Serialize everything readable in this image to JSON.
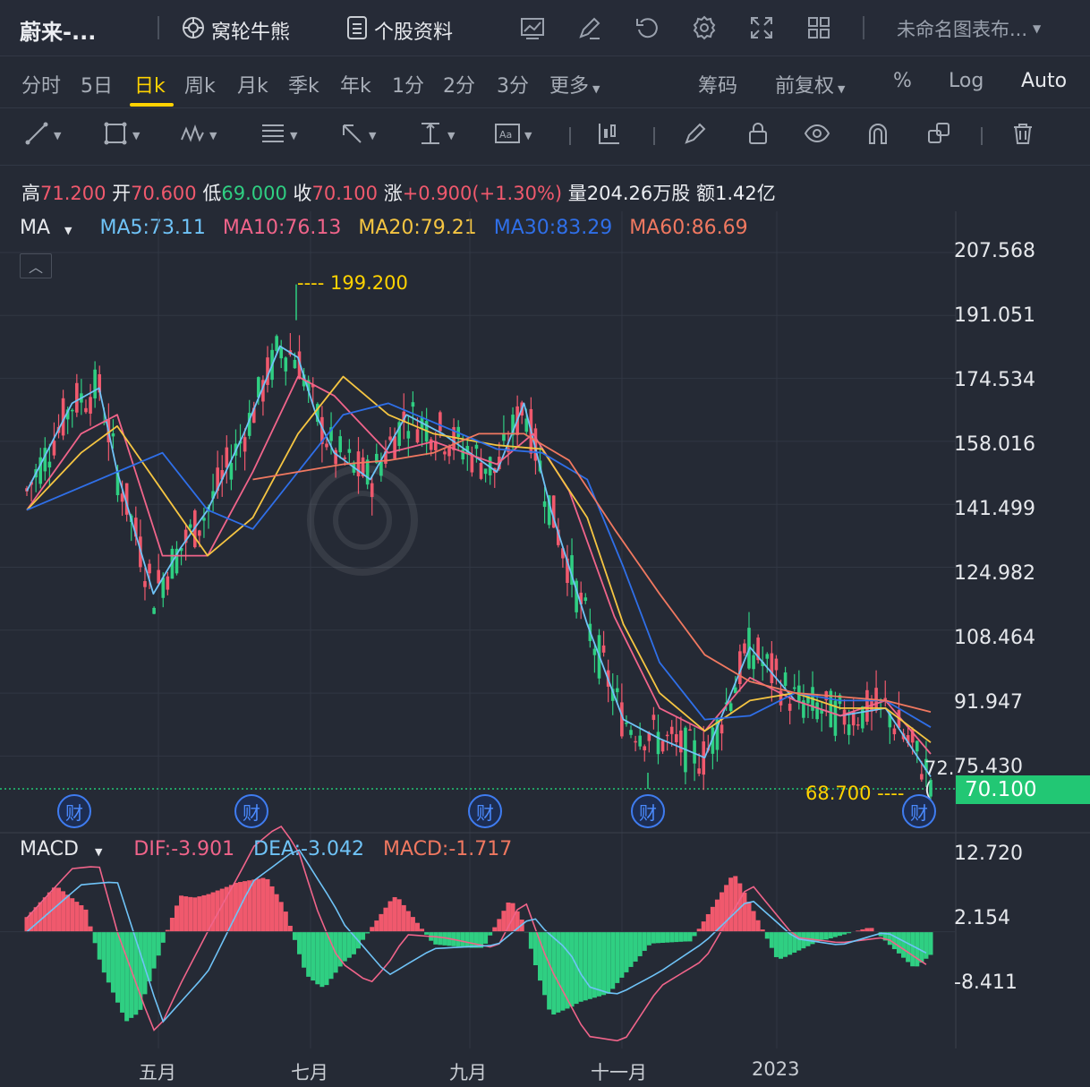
{
  "toolbar": {
    "title": "蔚来-...",
    "wolun_label": "窝轮牛熊",
    "stock_info_label": "个股资料",
    "template_label": "未命名图表布..."
  },
  "periods": [
    "分时",
    "5日",
    "日k",
    "周k",
    "月k",
    "季k",
    "年k",
    "1分",
    "2分",
    "3分",
    "更多"
  ],
  "active_period": "日k",
  "period_right": {
    "chips": "筹码",
    "adjust": "前复权",
    "percent": "%",
    "log": "Log",
    "auto": "Auto"
  },
  "quote": {
    "high_label": "高",
    "high": "71.200",
    "open_label": "开",
    "open": "70.600",
    "low_label": "低",
    "low": "69.000",
    "close_label": "收",
    "close": "70.100",
    "change_label": "涨",
    "change": "+0.900(+1.30%)",
    "volume_label": "量",
    "volume": "204.26万股",
    "amount_label": "额",
    "amount": "1.42亿"
  },
  "ma": {
    "label": "MA",
    "ma5": "MA5:73.11",
    "ma10": "MA10:76.13",
    "ma20": "MA20:79.21",
    "ma30": "MA30:83.29",
    "ma60": "MA60:86.69"
  },
  "macd": {
    "label": "MACD",
    "dif": "DIF:-3.901",
    "dea": "DEA:-3.042",
    "macd": "MACD:-1.717"
  },
  "price_axis": [
    "207.568",
    "191.051",
    "174.534",
    "158.016",
    "141.499",
    "124.982",
    "108.464",
    "91.947",
    "75.430"
  ],
  "macd_axis": [
    "12.720",
    "2.154",
    "-8.411"
  ],
  "current_price": "70.100",
  "last_price_right": "72.(",
  "high_marker": "---- 199.200",
  "low_marker": "68.700 ----",
  "months": [
    "五月",
    "七月",
    "九月",
    "十一月",
    "2023"
  ],
  "earnings_badge": "财",
  "colors": {
    "up": "#f0596d",
    "down": "#2fcf82",
    "ma5": "#6fc3f7",
    "ma10": "#f0648a",
    "ma20": "#f5c542",
    "ma30": "#2f6fe8",
    "ma60": "#f07860",
    "accent": "#ffd200"
  },
  "chart_data": {
    "type": "candlestick",
    "series": [
      {
        "name": "MA5",
        "x": [
          0,
          0.05,
          0.08,
          0.1,
          0.14,
          0.17,
          0.2,
          0.24,
          0.28,
          0.3,
          0.32,
          0.34,
          0.38,
          0.42,
          0.46,
          0.52,
          0.55,
          0.58,
          0.62,
          0.66,
          0.7,
          0.75,
          0.8,
          0.85,
          0.9,
          0.95,
          1
        ],
        "values": [
          145,
          168,
          172,
          150,
          118,
          130,
          140,
          160,
          183,
          180,
          165,
          155,
          148,
          165,
          160,
          150,
          168,
          140,
          110,
          85,
          80,
          75,
          104,
          90,
          86,
          88,
          70
        ]
      },
      {
        "name": "MA10",
        "x": [
          0,
          0.06,
          0.1,
          0.15,
          0.2,
          0.25,
          0.3,
          0.34,
          0.4,
          0.45,
          0.52,
          0.56,
          0.6,
          0.65,
          0.7,
          0.75,
          0.8,
          0.85,
          0.9,
          0.95,
          1
        ],
        "values": [
          140,
          160,
          165,
          128,
          128,
          150,
          175,
          170,
          155,
          158,
          152,
          160,
          145,
          112,
          88,
          82,
          96,
          90,
          86,
          90,
          76
        ]
      },
      {
        "name": "MA20",
        "x": [
          0,
          0.06,
          0.1,
          0.15,
          0.2,
          0.25,
          0.3,
          0.35,
          0.4,
          0.45,
          0.52,
          0.57,
          0.62,
          0.66,
          0.7,
          0.75,
          0.8,
          0.85,
          0.9,
          0.95,
          1
        ],
        "values": [
          140,
          155,
          162,
          145,
          128,
          138,
          160,
          175,
          165,
          160,
          157,
          156,
          138,
          110,
          92,
          82,
          90,
          92,
          88,
          88,
          79
        ]
      },
      {
        "name": "MA30",
        "x": [
          0,
          0.1,
          0.15,
          0.2,
          0.25,
          0.3,
          0.35,
          0.4,
          0.45,
          0.52,
          0.57,
          0.62,
          0.66,
          0.7,
          0.75,
          0.8,
          0.85,
          0.9,
          0.95,
          1
        ],
        "values": [
          140,
          150,
          155,
          140,
          135,
          150,
          165,
          168,
          163,
          156,
          155,
          148,
          125,
          100,
          85,
          86,
          92,
          90,
          90,
          83
        ]
      },
      {
        "name": "MA60",
        "x": [
          0.25,
          0.3,
          0.35,
          0.4,
          0.45,
          0.5,
          0.55,
          0.6,
          0.65,
          0.7,
          0.75,
          0.8,
          0.85,
          0.9,
          0.95,
          1
        ],
        "values": [
          148,
          150,
          152,
          153,
          155,
          160,
          160,
          153,
          135,
          118,
          102,
          95,
          92,
          91,
          90,
          87
        ]
      }
    ],
    "high": 199.2,
    "low": 68.7,
    "last": 70.1,
    "ylim": [
      75.43,
      207.568
    ],
    "x_ticks": [
      "五月",
      "七月",
      "九月",
      "十一月",
      "2023"
    ],
    "macd": {
      "dif": -3.901,
      "dea": -3.042,
      "hist": -1.717,
      "ylim": [
        -8.411,
        12.72
      ]
    }
  }
}
